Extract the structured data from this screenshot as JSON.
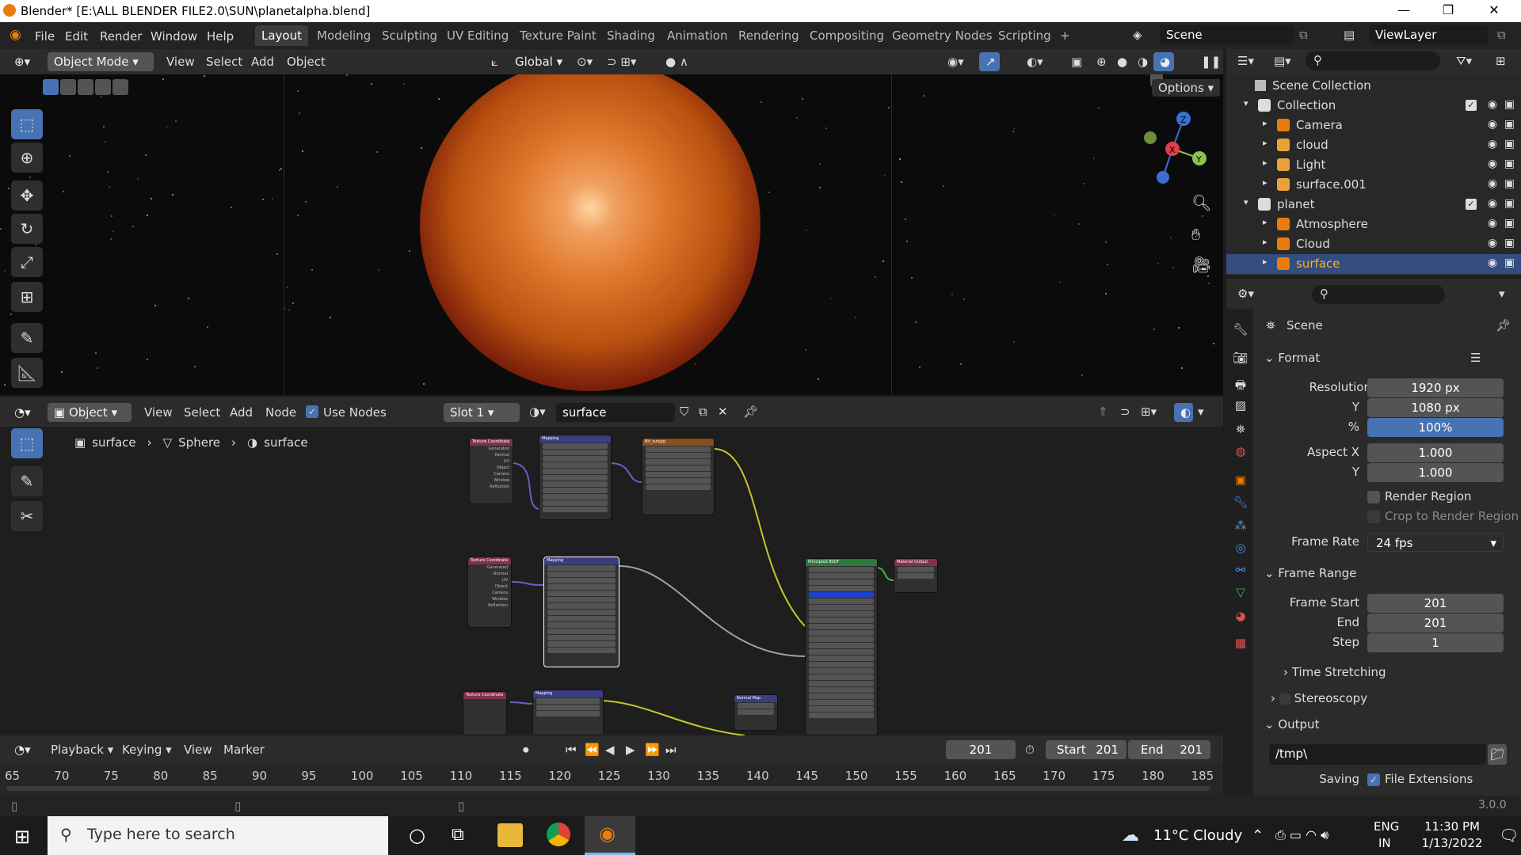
{
  "titlebar": {
    "title": "Blender* [E:\\ALL BLENDER FILE2.0\\SUN\\planetalpha.blend]",
    "minimize": "—",
    "maximize": "❐",
    "close": "✕"
  },
  "menu": [
    "File",
    "Edit",
    "Render",
    "Window",
    "Help"
  ],
  "workspaces": [
    "Layout",
    "Modeling",
    "Sculpting",
    "UV Editing",
    "Texture Paint",
    "Shading",
    "Animation",
    "Rendering",
    "Compositing",
    "Geometry Nodes",
    "Scripting",
    "+"
  ],
  "active_workspace": "Layout",
  "scene_field": "Scene",
  "viewlayer_field": "ViewLayer",
  "viewport_header": {
    "mode": "Object Mode",
    "items": [
      "View",
      "Select",
      "Add",
      "Object"
    ],
    "transform": "Global",
    "options": "Options"
  },
  "node_header": {
    "mode": "Object",
    "items": [
      "View",
      "Select",
      "Add",
      "Node"
    ],
    "use_nodes": "Use Nodes",
    "slot": "Slot 1",
    "material": "surface"
  },
  "breadcrumb": [
    "surface",
    "Sphere",
    "surface"
  ],
  "nodes": {
    "tex_coord": "Texture Coordinate",
    "mapping": "Mapping",
    "image": "Bit_sunjpg",
    "bsdf": "Principled BSDF",
    "output": "Material Output",
    "normal_map": "Normal Map",
    "tex_outputs": [
      "Generated",
      "Normal",
      "UV",
      "Object",
      "Camera",
      "Window",
      "Reflection"
    ],
    "bsdf_inputs": [
      "Base Color",
      "Subsurface",
      "Subsurface Radius",
      "Subsurface Color",
      "Metallic",
      "Specular",
      "Specular Tint",
      "Roughness",
      "Anisotropic",
      "Sheen",
      "Clearcoat",
      "IOR",
      "Transmission",
      "Emission",
      "Alpha",
      "Normal"
    ]
  },
  "timeline_header": {
    "items": [
      "Playback",
      "Keying",
      "View",
      "Marker"
    ],
    "current_frame": "201",
    "start_label": "Start",
    "start": "201",
    "end_label": "End",
    "end": "201"
  },
  "timeline_ticks": [
    "65",
    "70",
    "75",
    "80",
    "85",
    "90",
    "95",
    "100",
    "105",
    "110",
    "115",
    "120",
    "125",
    "130",
    "135",
    "140",
    "145",
    "150",
    "155",
    "160",
    "165",
    "170",
    "175",
    "180",
    "185"
  ],
  "outliner": {
    "root": "Scene Collection",
    "rows": [
      {
        "label": "Collection",
        "level": 1,
        "icon": "collection-icon",
        "check": true
      },
      {
        "label": "Camera",
        "level": 2,
        "icon": "camera-icon"
      },
      {
        "label": "cloud",
        "level": 2,
        "icon": "empty-icon"
      },
      {
        "label": "Light",
        "level": 2,
        "icon": "light-icon"
      },
      {
        "label": "surface.001",
        "level": 2,
        "icon": "empty-icon"
      },
      {
        "label": "planet",
        "level": 1,
        "icon": "collection-icon",
        "check": true
      },
      {
        "label": "Atmosphere",
        "level": 2,
        "icon": "mesh-icon"
      },
      {
        "label": "Cloud",
        "level": 2,
        "icon": "mesh-icon"
      },
      {
        "label": "surface",
        "level": 2,
        "icon": "mesh-icon",
        "selected": true
      }
    ]
  },
  "properties": {
    "context": "Scene",
    "format_header": "Format",
    "resolution_x_label": "Resolution X",
    "resolution_x": "1920 px",
    "resolution_y_label": "Y",
    "resolution_y": "1080 px",
    "percent_label": "%",
    "percent": "100%",
    "aspect_x_label": "Aspect X",
    "aspect_x": "1.000",
    "aspect_y_label": "Y",
    "aspect_y": "1.000",
    "render_region": "Render Region",
    "crop_region": "Crop to Render Region",
    "frame_rate_label": "Frame Rate",
    "frame_rate": "24 fps",
    "frame_range_header": "Frame Range",
    "frame_start_label": "Frame Start",
    "frame_start": "201",
    "end_label": "End",
    "end": "201",
    "step_label": "Step",
    "step": "1",
    "time_stretching": "Time Stretching",
    "stereoscopy": "Stereoscopy",
    "output_header": "Output",
    "output_path": "/tmp\\",
    "saving_label": "Saving",
    "file_extensions": "File Extensions"
  },
  "status": {
    "version": "3.0.0"
  },
  "taskbar": {
    "search_placeholder": "Type here to search",
    "weather": "11°C  Cloudy",
    "lang1": "ENG",
    "lang2": "IN",
    "time": "11:30 PM",
    "date": "1/13/2022"
  },
  "colors": {
    "accent": "#4772b3",
    "selected": "#334d80",
    "blender_orange": "#e87d0d"
  }
}
